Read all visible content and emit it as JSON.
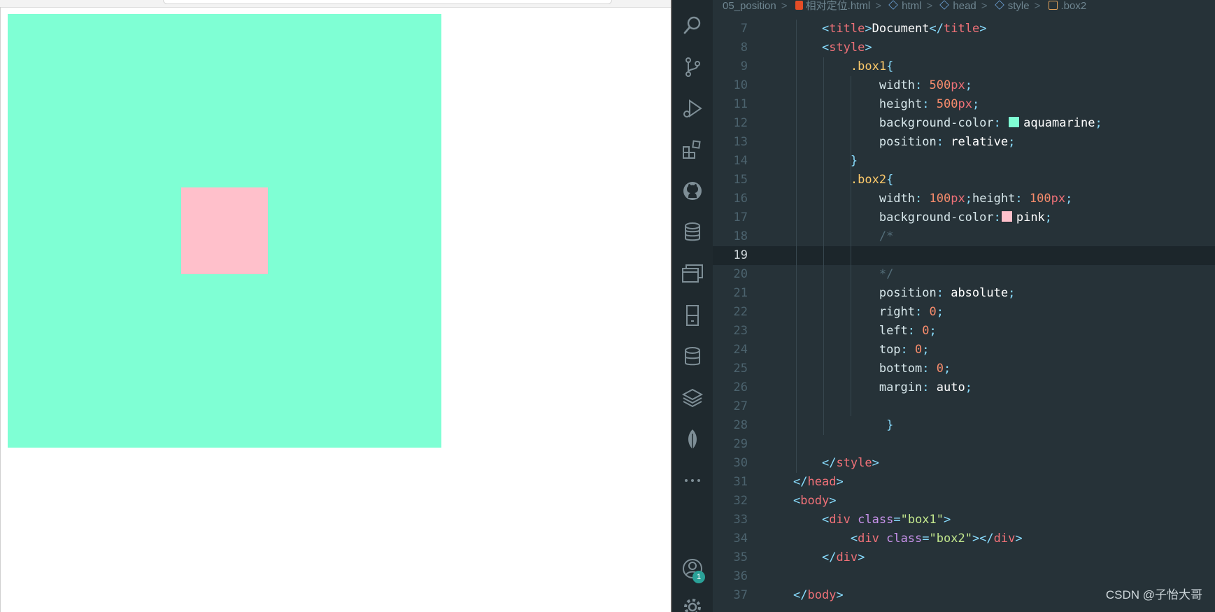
{
  "breadcrumbs": {
    "folder": "05_position",
    "file": "相对定位.html",
    "html": "html",
    "head": "head",
    "style": "style",
    "box2": ".box2"
  },
  "preview": {
    "box1_color": "#7fffd4",
    "box2_color": "#ffc0cb"
  },
  "editor": {
    "current_line": 19,
    "activity_icons": [
      "search-icon",
      "source-control-icon",
      "run-debug-icon",
      "extensions-icon",
      "github-icon",
      "database-icon",
      "windows-icon",
      "device-icon",
      "database2-icon",
      "layers-icon",
      "leaf-icon",
      "more-icon",
      "account-icon",
      "settings-icon"
    ],
    "account_badge": "1",
    "lines": [
      {
        "n": "7",
        "t": [
          [
            "",
            "    "
          ],
          [
            "br",
            "<"
          ],
          [
            "tag",
            "title"
          ],
          [
            "br",
            ">"
          ],
          [
            "kw",
            "Document"
          ],
          [
            "br",
            "</"
          ],
          [
            "tag",
            "title"
          ],
          [
            "br",
            ">"
          ]
        ]
      },
      {
        "n": "8",
        "t": [
          [
            "",
            "    "
          ],
          [
            "br",
            "<"
          ],
          [
            "tag",
            "style"
          ],
          [
            "br",
            ">"
          ]
        ]
      },
      {
        "n": "9",
        "t": [
          [
            "",
            "        "
          ],
          [
            "sel-c",
            ".box1"
          ],
          [
            "br",
            "{"
          ]
        ]
      },
      {
        "n": "10",
        "t": [
          [
            "",
            "            "
          ],
          [
            "prop",
            "width"
          ],
          [
            "pun",
            ": "
          ],
          [
            "num",
            "500"
          ],
          [
            "unit",
            "px"
          ],
          [
            "pun",
            ";"
          ]
        ]
      },
      {
        "n": "11",
        "t": [
          [
            "",
            "            "
          ],
          [
            "prop",
            "height"
          ],
          [
            "pun",
            ": "
          ],
          [
            "num",
            "500"
          ],
          [
            "unit",
            "px"
          ],
          [
            "pun",
            ";"
          ]
        ]
      },
      {
        "n": "12",
        "t": [
          [
            "",
            "            "
          ],
          [
            "prop",
            "background-color"
          ],
          [
            "pun",
            ": "
          ],
          [
            "swatch",
            "#7fffd4"
          ],
          [
            "kw",
            "aquamarine"
          ],
          [
            "pun",
            ";"
          ]
        ]
      },
      {
        "n": "13",
        "t": [
          [
            "",
            "            "
          ],
          [
            "prop",
            "position"
          ],
          [
            "pun",
            ": "
          ],
          [
            "kw",
            "relative"
          ],
          [
            "pun",
            ";"
          ]
        ]
      },
      {
        "n": "14",
        "t": [
          [
            "",
            "        "
          ],
          [
            "br",
            "}"
          ]
        ]
      },
      {
        "n": "15",
        "t": [
          [
            "",
            "        "
          ],
          [
            "sel-c",
            ".box2"
          ],
          [
            "br",
            "{"
          ]
        ]
      },
      {
        "n": "16",
        "t": [
          [
            "",
            "            "
          ],
          [
            "prop",
            "width"
          ],
          [
            "pun",
            ": "
          ],
          [
            "num",
            "100"
          ],
          [
            "unit",
            "px"
          ],
          [
            "pun",
            ";"
          ],
          [
            "prop",
            "height"
          ],
          [
            "pun",
            ": "
          ],
          [
            "num",
            "100"
          ],
          [
            "unit",
            "px"
          ],
          [
            "pun",
            ";"
          ]
        ]
      },
      {
        "n": "17",
        "t": [
          [
            "",
            "            "
          ],
          [
            "prop",
            "background-color"
          ],
          [
            "pun",
            ":"
          ],
          [
            "swatch",
            "#ffc0cb"
          ],
          [
            "kw",
            "pink"
          ],
          [
            "pun",
            ";"
          ]
        ]
      },
      {
        "n": "18",
        "t": [
          [
            "",
            "            "
          ],
          [
            "cmt",
            "/*"
          ]
        ]
      },
      {
        "n": "19",
        "t": [
          [
            "",
            ""
          ]
        ]
      },
      {
        "n": "20",
        "t": [
          [
            "",
            "            "
          ],
          [
            "cmt",
            "*/"
          ]
        ]
      },
      {
        "n": "21",
        "t": [
          [
            "",
            "            "
          ],
          [
            "prop",
            "position"
          ],
          [
            "pun",
            ": "
          ],
          [
            "kw",
            "absolute"
          ],
          [
            "pun",
            ";"
          ]
        ]
      },
      {
        "n": "22",
        "t": [
          [
            "",
            "            "
          ],
          [
            "prop",
            "right"
          ],
          [
            "pun",
            ": "
          ],
          [
            "num",
            "0"
          ],
          [
            "pun",
            ";"
          ]
        ]
      },
      {
        "n": "23",
        "t": [
          [
            "",
            "            "
          ],
          [
            "prop",
            "left"
          ],
          [
            "pun",
            ": "
          ],
          [
            "num",
            "0"
          ],
          [
            "pun",
            ";"
          ]
        ]
      },
      {
        "n": "24",
        "t": [
          [
            "",
            "            "
          ],
          [
            "prop",
            "top"
          ],
          [
            "pun",
            ": "
          ],
          [
            "num",
            "0"
          ],
          [
            "pun",
            ";"
          ]
        ]
      },
      {
        "n": "25",
        "t": [
          [
            "",
            "            "
          ],
          [
            "prop",
            "bottom"
          ],
          [
            "pun",
            ": "
          ],
          [
            "num",
            "0"
          ],
          [
            "pun",
            ";"
          ]
        ]
      },
      {
        "n": "26",
        "t": [
          [
            "",
            "            "
          ],
          [
            "prop",
            "margin"
          ],
          [
            "pun",
            ": "
          ],
          [
            "kw",
            "auto"
          ],
          [
            "pun",
            ";"
          ]
        ]
      },
      {
        "n": "27",
        "t": [
          [
            "",
            ""
          ]
        ]
      },
      {
        "n": "28",
        "t": [
          [
            "",
            "             "
          ],
          [
            "br",
            "}"
          ]
        ]
      },
      {
        "n": "29",
        "t": [
          [
            "",
            ""
          ]
        ]
      },
      {
        "n": "30",
        "t": [
          [
            "",
            "    "
          ],
          [
            "br",
            "</"
          ],
          [
            "tag",
            "style"
          ],
          [
            "br",
            ">"
          ]
        ]
      },
      {
        "n": "31",
        "t": [
          [
            "br",
            "</"
          ],
          [
            "tag",
            "head"
          ],
          [
            "br",
            ">"
          ]
        ]
      },
      {
        "n": "32",
        "t": [
          [
            "br",
            "<"
          ],
          [
            "tag",
            "body"
          ],
          [
            "br",
            ">"
          ]
        ]
      },
      {
        "n": "33",
        "t": [
          [
            "",
            "    "
          ],
          [
            "br",
            "<"
          ],
          [
            "tag",
            "div"
          ],
          [
            "",
            ""
          ],
          [
            "attr",
            " class"
          ],
          [
            "pun",
            "="
          ],
          [
            "str",
            "\"box1\""
          ],
          [
            "br",
            ">"
          ]
        ]
      },
      {
        "n": "34",
        "t": [
          [
            "",
            "        "
          ],
          [
            "br",
            "<"
          ],
          [
            "tag",
            "div"
          ],
          [
            "attr",
            " class"
          ],
          [
            "pun",
            "="
          ],
          [
            "str",
            "\"box2\""
          ],
          [
            "br",
            "></"
          ],
          [
            "tag",
            "div"
          ],
          [
            "br",
            ">"
          ]
        ]
      },
      {
        "n": "35",
        "t": [
          [
            "",
            "    "
          ],
          [
            "br",
            "</"
          ],
          [
            "tag",
            "div"
          ],
          [
            "br",
            ">"
          ]
        ]
      },
      {
        "n": "36",
        "t": [
          [
            "",
            ""
          ]
        ]
      },
      {
        "n": "37",
        "t": [
          [
            "br",
            "</"
          ],
          [
            "tag",
            "body"
          ],
          [
            "br",
            ">"
          ]
        ]
      }
    ]
  },
  "watermark": "CSDN @子怡大哥"
}
